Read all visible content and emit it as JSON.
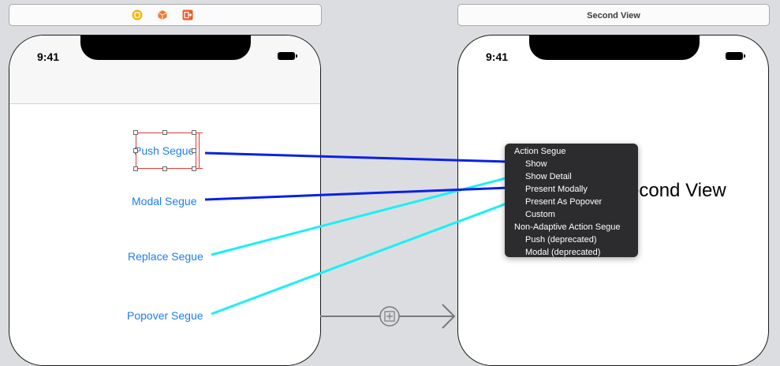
{
  "scene_left": {
    "icons": [
      "view-controller-icon",
      "first-responder-icon",
      "exit-icon"
    ]
  },
  "scene_right": {
    "title": "Second View"
  },
  "phone_left": {
    "time": "9:41",
    "buttons": {
      "push": "Push Segue",
      "modal": "Modal Segue",
      "replace": "Replace Segue",
      "popover": "Popover Segue"
    }
  },
  "phone_right": {
    "time": "9:41",
    "view_label": "Second View"
  },
  "segue_menu": {
    "header_action": "Action Segue",
    "action_items": [
      "Show",
      "Show Detail",
      "Present Modally",
      "Present As Popover",
      "Custom"
    ],
    "header_nonadaptive": "Non-Adaptive Action Segue",
    "nonadaptive_items": [
      "Push (deprecated)",
      "Modal (deprecated)"
    ]
  },
  "colors": {
    "connection_dark": "#0a20e6",
    "connection_cyan": "#19f0f5",
    "button_text": "#1e7cf2",
    "selection": "#e23a3a",
    "menu_bg": "#2c2c2e"
  }
}
